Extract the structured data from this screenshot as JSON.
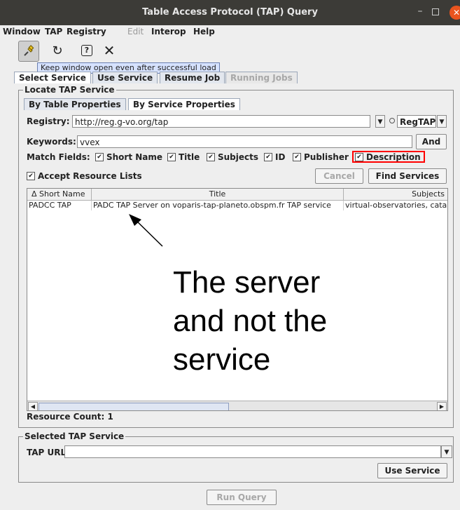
{
  "window": {
    "title": "Table Access Protocol (TAP) Query",
    "minimize": "–",
    "close": "✕"
  },
  "menu": [
    {
      "label": "Window",
      "disabled": false
    },
    {
      "label": "TAP",
      "disabled": false
    },
    {
      "label": "Registry",
      "disabled": false
    },
    {
      "label": "Edit",
      "disabled": true
    },
    {
      "label": "Interop",
      "disabled": false
    },
    {
      "label": "Help",
      "disabled": false
    }
  ],
  "toolbar": {
    "pin_icon": "📌",
    "reload_icon": "↻",
    "help_icon": "?",
    "close_icon": "✕",
    "tooltip": "Keep window open even after successful load"
  },
  "tabs": [
    "Select Service",
    "Use Service",
    "Resume Job",
    "Running Jobs"
  ],
  "locate": {
    "legend": "Locate TAP Service",
    "subtabs": [
      "By Table Properties",
      "By Service Properties"
    ],
    "registry_label": "Registry:",
    "registry_value": "http://reg.g-vo.org/tap",
    "regtap_label": "RegTAP",
    "keywords_label": "Keywords:",
    "keywords_value": "vvex",
    "and_button": "And",
    "match_label": "Match Fields:",
    "match_fields": [
      "Short Name",
      "Title",
      "Subjects",
      "ID",
      "Publisher",
      "Description"
    ],
    "accept_label": "Accept Resource Lists",
    "cancel_button": "Cancel",
    "find_button": "Find Services",
    "columns": [
      "Δ Short Name",
      "Title",
      "Subjects"
    ],
    "rows": [
      [
        "PADCC TAP",
        "PADC TAP Server on voparis-tap-planeto.obspm.fr TAP service",
        "virtual-observatories, cata"
      ]
    ],
    "resource_count": "Resource Count: 1"
  },
  "annotation": {
    "text_lines": [
      "The server",
      "and not the",
      "service"
    ]
  },
  "selected": {
    "legend": "Selected TAP Service",
    "tap_url_label": "TAP URL:",
    "tap_url_value": "",
    "use_service_button": "Use Service"
  },
  "run_query_button": "Run Query",
  "checkmark": "✔",
  "colors": {
    "highlight": "#ff0000",
    "titlebar": "#3c3b37",
    "close": "#e9541e"
  }
}
